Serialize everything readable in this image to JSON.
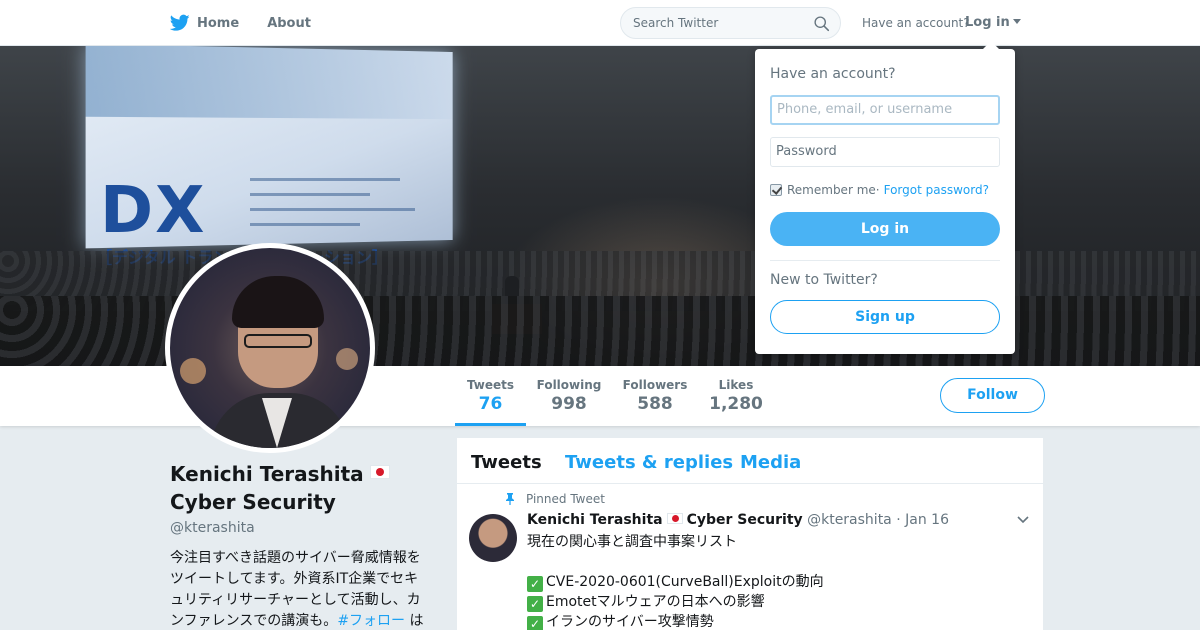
{
  "topbar": {
    "nav": [
      {
        "label": "Home",
        "icon": "twitter-bird-icon"
      },
      {
        "label": "About"
      }
    ],
    "search_placeholder": "Search Twitter",
    "have_account": "Have an account?",
    "login_label": "Log in"
  },
  "header_photo": {
    "screen_title": "DX",
    "screen_subtitle": "［デジタル トランスフォーメーション］"
  },
  "stats": [
    {
      "label": "Tweets",
      "value": "76",
      "active": true
    },
    {
      "label": "Following",
      "value": "998"
    },
    {
      "label": "Followers",
      "value": "588"
    },
    {
      "label": "Likes",
      "value": "1,280"
    }
  ],
  "follow_label": "Follow",
  "profile": {
    "name_line1": "Kenichi Terashita",
    "name_line2": "Cyber Security",
    "handle": "@kterashita",
    "bio_text": "今注目すべき話題のサイバー脅威情報をツイートしてます。外資系IT企業でセキュリティリサーチャーとして活動し、カンファレンスでの講演も。",
    "bio_tag": "#フォロー",
    "bio_after": " は"
  },
  "timeline": {
    "tabs": [
      "Tweets",
      "Tweets & replies",
      "Media"
    ],
    "pinned_label": "Pinned Tweet",
    "tweet": {
      "author": "Kenichi Terashita",
      "author_suffix": "Cyber Security",
      "handle": "@kterashita",
      "date": "Jan 16",
      "lines": [
        "現在の関心事と調査中事案リスト",
        "",
        "CVE-2020-0601(CurveBall)Exploitの動向",
        "Emotetマルウェアの日本への影響",
        "イランのサイバー攻撃情勢"
      ]
    }
  },
  "login_dropdown": {
    "title": "Have an account?",
    "username_placeholder": "Phone, email, or username",
    "password_placeholder": "Password",
    "remember_label": "Remember me",
    "separator": " · ",
    "forgot_label": "Forgot password?",
    "login_button": "Log in",
    "new_label": "New to Twitter?",
    "signup_button": "Sign up"
  },
  "colors": {
    "accent": "#1da1f2",
    "login_button_bg": "#4ab3f4",
    "page_bg": "#e6ecf0"
  }
}
